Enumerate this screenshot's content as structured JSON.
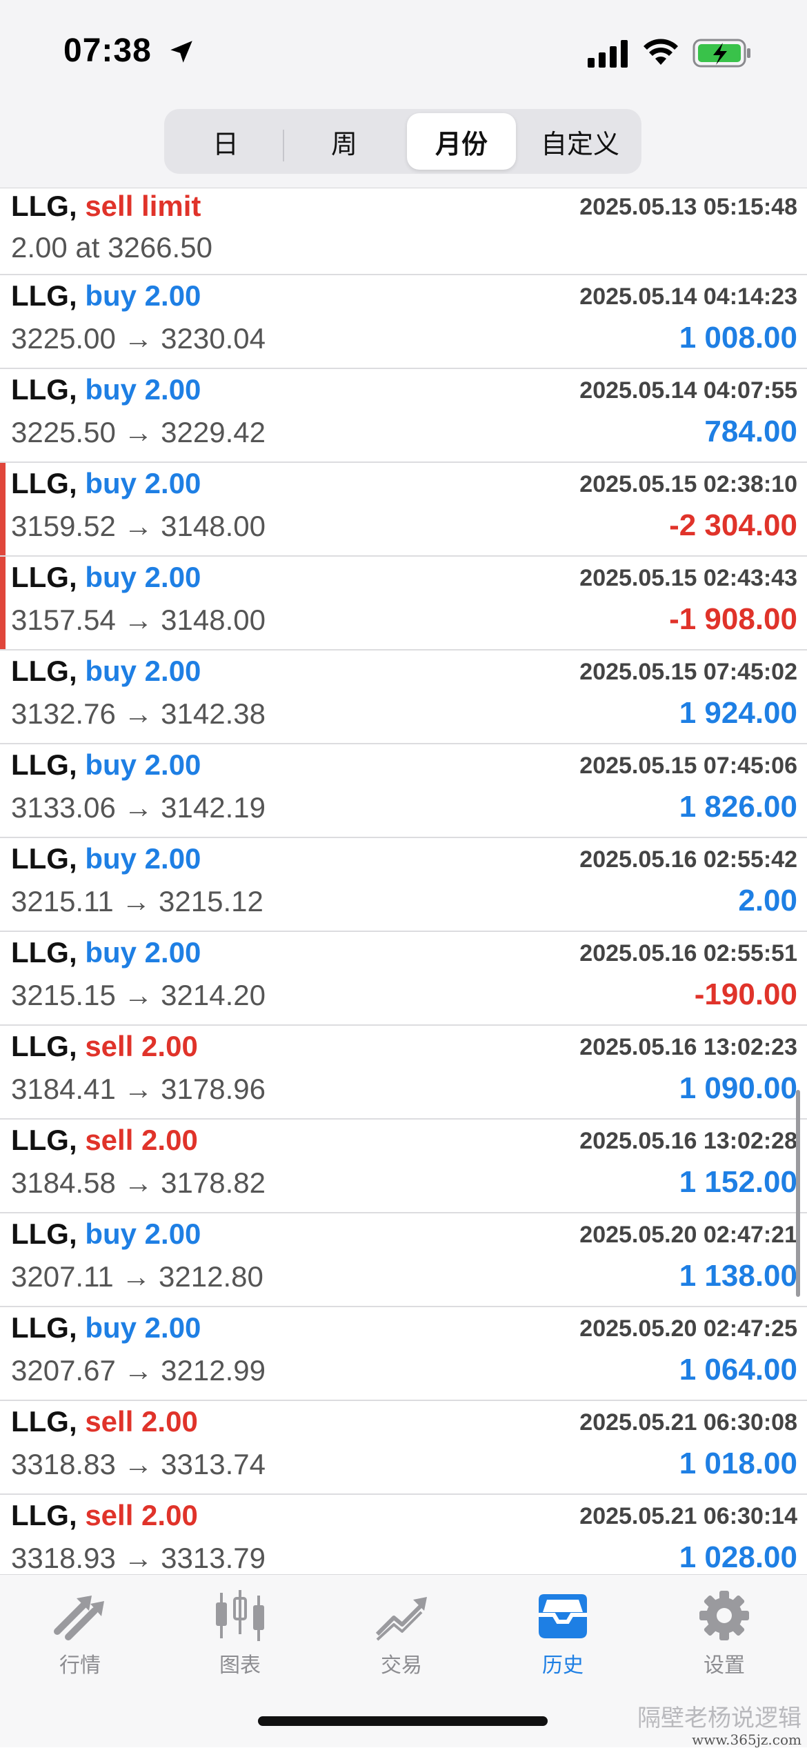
{
  "status_bar": {
    "time": "07:38"
  },
  "segments": [
    "日",
    "周",
    "月份",
    "自定义"
  ],
  "active_segment": "月份",
  "orders": [
    {
      "symbol": "LLG,",
      "action": "sell limit",
      "action_color": "red",
      "datetime": "2025.05.13 05:15:48",
      "prices": "2.00 at 3266.50",
      "profit": "",
      "profit_color": "blue",
      "flag": false
    },
    {
      "symbol": "LLG,",
      "action": "buy 2.00",
      "action_color": "blue",
      "datetime": "2025.05.14 04:14:23",
      "prices": "3225.00 → 3230.04",
      "profit": "1 008.00",
      "profit_color": "blue",
      "flag": false
    },
    {
      "symbol": "LLG,",
      "action": "buy 2.00",
      "action_color": "blue",
      "datetime": "2025.05.14 04:07:55",
      "prices": "3225.50 → 3229.42",
      "profit": "784.00",
      "profit_color": "blue",
      "flag": false
    },
    {
      "symbol": "LLG,",
      "action": "buy 2.00",
      "action_color": "blue",
      "datetime": "2025.05.15 02:38:10",
      "prices": "3159.52 → 3148.00",
      "profit": "-2 304.00",
      "profit_color": "red",
      "flag": true
    },
    {
      "symbol": "LLG,",
      "action": "buy 2.00",
      "action_color": "blue",
      "datetime": "2025.05.15 02:43:43",
      "prices": "3157.54 → 3148.00",
      "profit": "-1 908.00",
      "profit_color": "red",
      "flag": true
    },
    {
      "symbol": "LLG,",
      "action": "buy 2.00",
      "action_color": "blue",
      "datetime": "2025.05.15 07:45:02",
      "prices": "3132.76 → 3142.38",
      "profit": "1 924.00",
      "profit_color": "blue",
      "flag": false
    },
    {
      "symbol": "LLG,",
      "action": "buy 2.00",
      "action_color": "blue",
      "datetime": "2025.05.15 07:45:06",
      "prices": "3133.06 → 3142.19",
      "profit": "1 826.00",
      "profit_color": "blue",
      "flag": false
    },
    {
      "symbol": "LLG,",
      "action": "buy 2.00",
      "action_color": "blue",
      "datetime": "2025.05.16 02:55:42",
      "prices": "3215.11 → 3215.12",
      "profit": "2.00",
      "profit_color": "blue",
      "flag": false
    },
    {
      "symbol": "LLG,",
      "action": "buy 2.00",
      "action_color": "blue",
      "datetime": "2025.05.16 02:55:51",
      "prices": "3215.15 → 3214.20",
      "profit": "-190.00",
      "profit_color": "red",
      "flag": false
    },
    {
      "symbol": "LLG,",
      "action": "sell 2.00",
      "action_color": "red",
      "datetime": "2025.05.16 13:02:23",
      "prices": "3184.41 → 3178.96",
      "profit": "1 090.00",
      "profit_color": "blue",
      "flag": false
    },
    {
      "symbol": "LLG,",
      "action": "sell 2.00",
      "action_color": "red",
      "datetime": "2025.05.16 13:02:28",
      "prices": "3184.58 → 3178.82",
      "profit": "1 152.00",
      "profit_color": "blue",
      "flag": false
    },
    {
      "symbol": "LLG,",
      "action": "buy 2.00",
      "action_color": "blue",
      "datetime": "2025.05.20 02:47:21",
      "prices": "3207.11 → 3212.80",
      "profit": "1 138.00",
      "profit_color": "blue",
      "flag": false
    },
    {
      "symbol": "LLG,",
      "action": "buy 2.00",
      "action_color": "blue",
      "datetime": "2025.05.20 02:47:25",
      "prices": "3207.67 → 3212.99",
      "profit": "1 064.00",
      "profit_color": "blue",
      "flag": false
    },
    {
      "symbol": "LLG,",
      "action": "sell 2.00",
      "action_color": "red",
      "datetime": "2025.05.21 06:30:08",
      "prices": "3318.83 → 3313.74",
      "profit": "1 018.00",
      "profit_color": "blue",
      "flag": false
    },
    {
      "symbol": "LLG,",
      "action": "sell 2.00",
      "action_color": "red",
      "datetime": "2025.05.21 06:30:14",
      "prices": "3318.93 → 3313.79",
      "profit": "1 028.00",
      "profit_color": "blue",
      "flag": false
    }
  ],
  "tabs": [
    {
      "label": "行情",
      "icon": "quotes-arrows-icon",
      "active": false
    },
    {
      "label": "图表",
      "icon": "candlestick-chart-icon",
      "active": false
    },
    {
      "label": "交易",
      "icon": "trade-trend-icon",
      "active": false
    },
    {
      "label": "历史",
      "icon": "history-tray-icon",
      "active": true
    },
    {
      "label": "设置",
      "icon": "gear-icon",
      "active": false
    }
  ],
  "colors": {
    "blue": "#1e7fe4",
    "red": "#e0332a",
    "tab_inactive": "#8c8c90"
  },
  "watermark": {
    "line1": "隔壁老杨说逻辑",
    "line2": "www.365jz.com"
  }
}
